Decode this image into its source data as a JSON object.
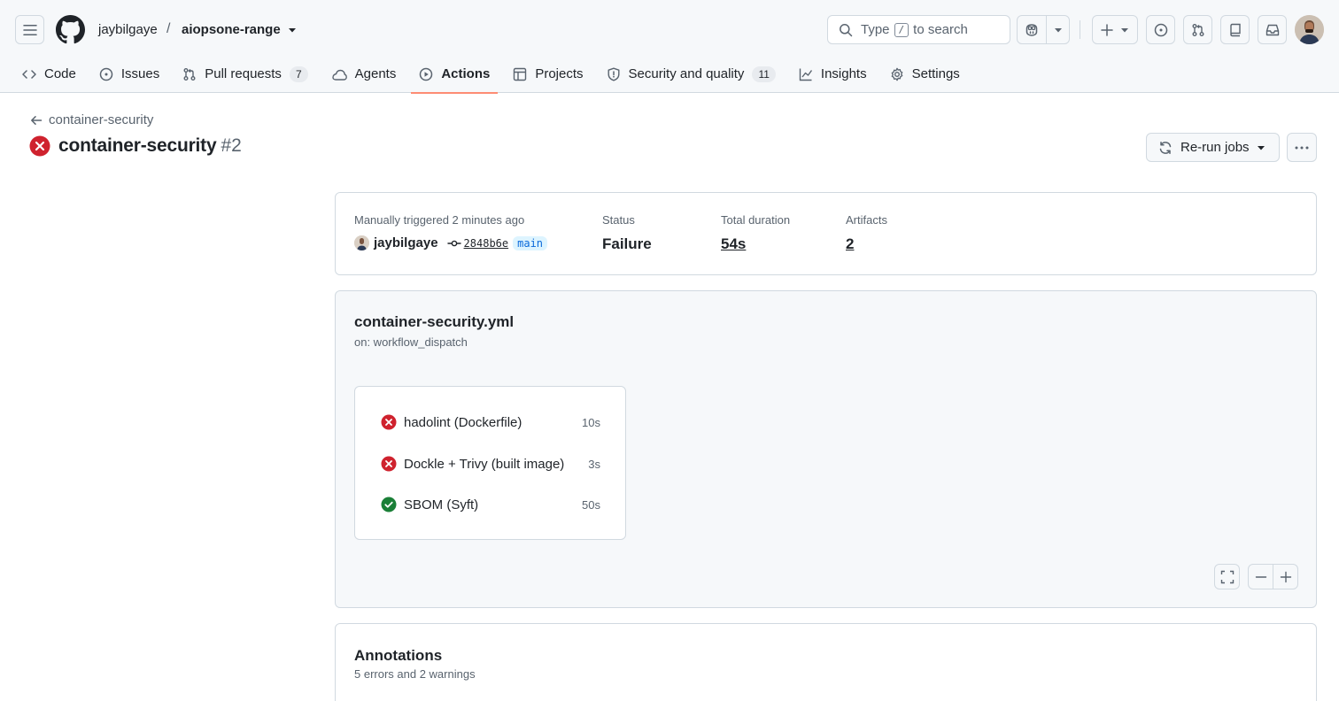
{
  "header": {
    "owner": "jaybilgaye",
    "separator": "/",
    "repo": "aiopsone-range",
    "search": {
      "prefix": "Type",
      "key": "/",
      "suffix": "to search"
    }
  },
  "tabs": [
    {
      "label": "Code",
      "icon": "code-icon"
    },
    {
      "label": "Issues",
      "icon": "issue-icon"
    },
    {
      "label": "Pull requests",
      "icon": "pull-request-icon",
      "count": "7"
    },
    {
      "label": "Agents",
      "icon": "agent-icon"
    },
    {
      "label": "Actions",
      "icon": "play-icon",
      "active": true
    },
    {
      "label": "Projects",
      "icon": "table-icon"
    },
    {
      "label": "Security and quality",
      "icon": "shield-icon",
      "count": "11"
    },
    {
      "label": "Insights",
      "icon": "graph-icon"
    },
    {
      "label": "Settings",
      "icon": "gear-icon"
    }
  ],
  "page": {
    "back_label": "container-security",
    "title": "container-security",
    "run_number": "#2",
    "rerun_label": "Re-run jobs"
  },
  "summary": {
    "trigger_label": "Manually triggered 2 minutes ago",
    "actor": "jaybilgaye",
    "commit": "2848b6e",
    "branch": "main",
    "status_label": "Status",
    "status_value": "Failure",
    "duration_label": "Total duration",
    "duration_value": "54s",
    "artifacts_label": "Artifacts",
    "artifacts_value": "2"
  },
  "workflow": {
    "file": "container-security.yml",
    "trigger": "on: workflow_dispatch",
    "jobs": [
      {
        "name": "hadolint (Dockerfile)",
        "duration": "10s",
        "status": "failure"
      },
      {
        "name": "Dockle + Trivy (built image)",
        "duration": "3s",
        "status": "failure"
      },
      {
        "name": "SBOM (Syft)",
        "duration": "50s",
        "status": "success"
      }
    ]
  },
  "annotations": {
    "title": "Annotations",
    "summary": "5 errors and 2 warnings"
  },
  "colors": {
    "failure": "#cf222e",
    "success": "#1a7f37",
    "accent_underline": "#fd8c73",
    "branch_text": "#0969da",
    "branch_bg": "#ddf4ff"
  }
}
